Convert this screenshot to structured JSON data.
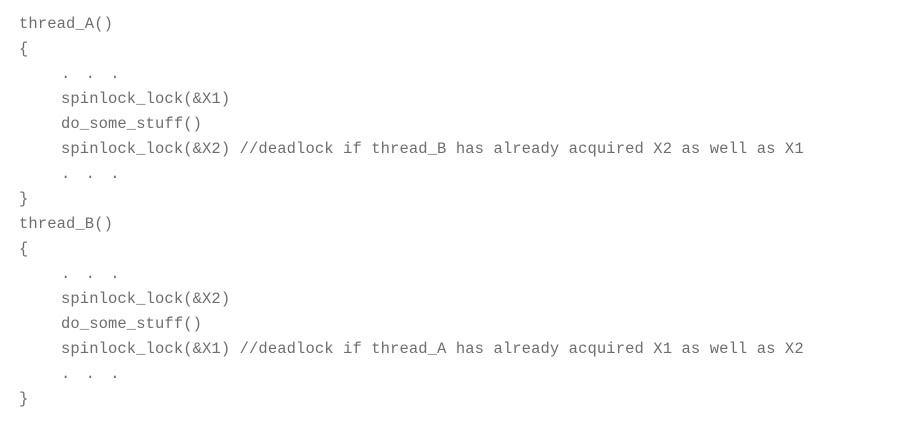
{
  "code": {
    "lines": [
      "thread_A()",
      "{",
      ". . .",
      "spinlock_lock(&X1)",
      "do_some_stuff()",
      "spinlock_lock(&X2) //deadlock if thread_B has already acquired X2 as well as X1",
      ". . .",
      "}",
      "thread_B()",
      "{",
      ". . .",
      "spinlock_lock(&X2)",
      "do_some_stuff()",
      "spinlock_lock(&X1) //deadlock if thread_A has already acquired X1 as well as X2",
      ". . .",
      "}"
    ]
  }
}
